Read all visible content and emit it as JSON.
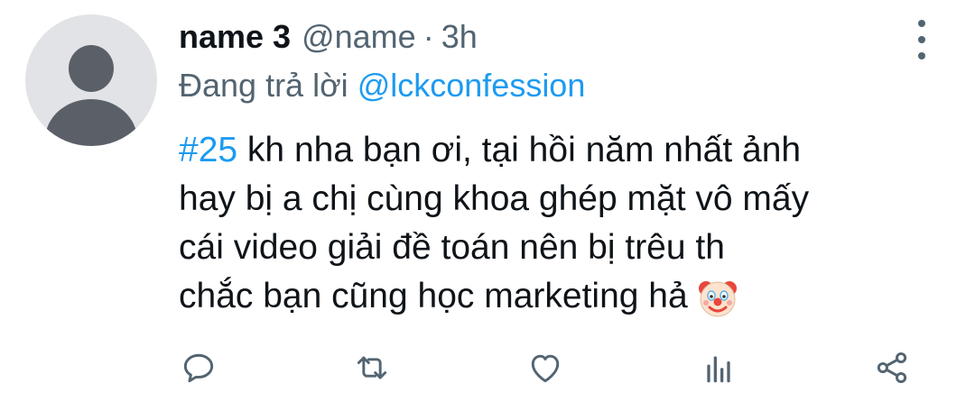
{
  "tweet": {
    "display_name": "name 3",
    "handle": "@name",
    "separator": "·",
    "time": "3h",
    "replying_prefix": "Đang trả lời",
    "replying_to": "@lckconfession",
    "hashtag": "#25",
    "text_lines": [
      " kh nha bạn ơi, tại hồi năm nhất ảnh",
      "hay bị a chị cùng khoa ghép mặt vô mấy",
      "cái video giải đề toán nên bị trêu th",
      "chắc bạn cũng học marketing hả"
    ],
    "emoji": "clown-face-emoji"
  },
  "actions": {
    "reply_icon": "comment-bubble-icon",
    "retweet_icon": "retweet-icon",
    "like_icon": "heart-icon",
    "views_icon": "analytics-bars-icon",
    "share_icon": "share-icon"
  },
  "colors": {
    "accent": "#1d9bf0",
    "secondary_text": "#536471",
    "primary_text": "#0f1419",
    "avatar_bg": "#e1e3e6",
    "avatar_fg": "#5b6068"
  }
}
